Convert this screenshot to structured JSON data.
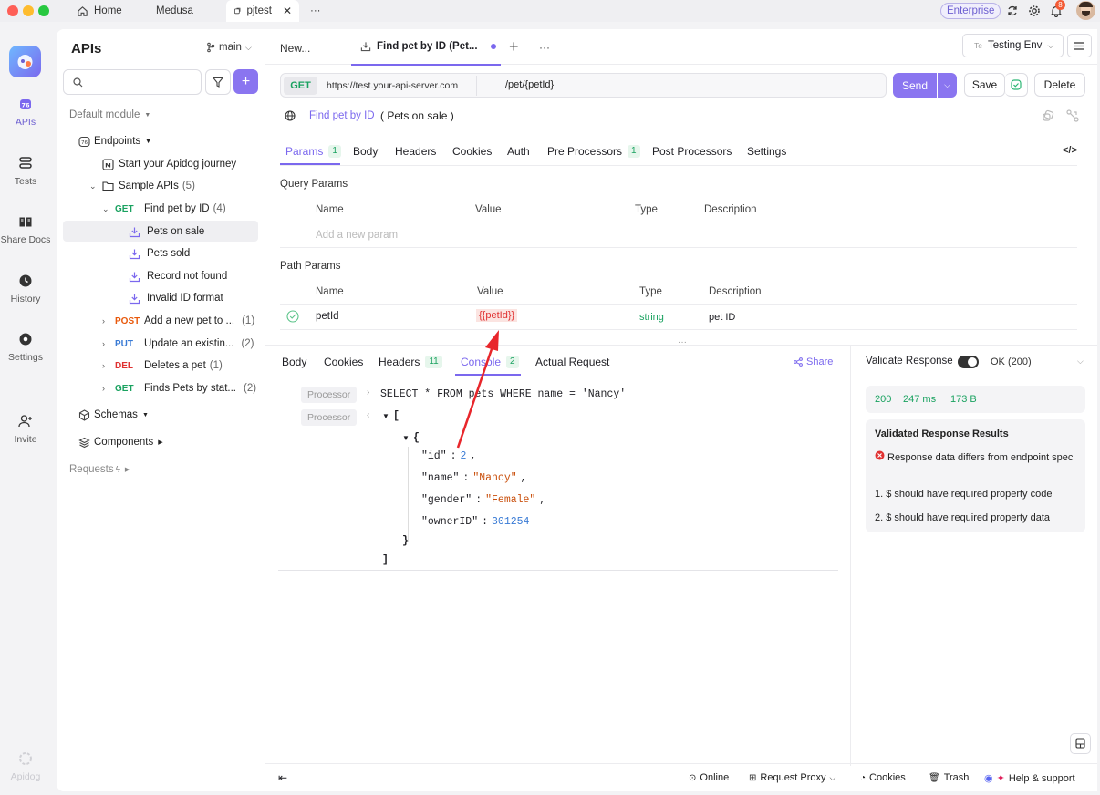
{
  "topbar": {
    "tabs": [
      {
        "label": "Home"
      },
      {
        "label": "Medusa"
      },
      {
        "label": "pjtest"
      }
    ],
    "more": "···",
    "enterprise": "Enterprise",
    "notif_count": "8"
  },
  "rail": {
    "items": [
      {
        "label": "APIs",
        "icon": "apis-icon"
      },
      {
        "label": "Tests",
        "icon": "tests-icon"
      },
      {
        "label": "Share Docs",
        "icon": "share-docs-icon"
      },
      {
        "label": "History",
        "icon": "history-icon"
      },
      {
        "label": "Settings",
        "icon": "settings-icon"
      },
      {
        "label": "Invite",
        "icon": "invite-icon"
      }
    ],
    "brand": "Apidog"
  },
  "sidebar": {
    "title": "APIs",
    "branch": "main",
    "search_placeholder": "",
    "module": "Default module",
    "endpoints_label": "Endpoints",
    "start_journey": "Start your Apidog journey",
    "sample_folder": "Sample APIs",
    "sample_count": "(5)",
    "find_pet": {
      "method": "GET",
      "label": "Find pet by ID",
      "count": "(4)"
    },
    "cases": [
      "Pets on sale",
      "Pets sold",
      "Record not found",
      "Invalid ID format"
    ],
    "others": [
      {
        "method": "POST",
        "label": "Add a new pet to ...",
        "count": "(1)"
      },
      {
        "method": "PUT",
        "label": "Update an existin...",
        "count": "(2)"
      },
      {
        "method": "DEL",
        "label": "Deletes a pet",
        "count": "(1)"
      },
      {
        "method": "GET",
        "label": "Finds Pets by stat...",
        "count": "(2)"
      }
    ],
    "schemas": "Schemas",
    "components": "Components",
    "requests": "Requests"
  },
  "main": {
    "tabs": {
      "new": "New...",
      "active": "Find pet by ID (Pet...",
      "more": "···"
    },
    "env": {
      "prefix": "Te",
      "label": "Testing Env"
    },
    "request": {
      "method": "GET",
      "base_url": "https://test.your-api-server.com",
      "path": "/pet/{petId}",
      "send": "Send",
      "save": "Save",
      "delete": "Delete"
    },
    "breadcrumb": {
      "endpoint": "Find pet by ID",
      "case": "( Pets on sale )"
    },
    "req_tabs": [
      {
        "label": "Params",
        "badge": "1"
      },
      {
        "label": "Body",
        "badge": ""
      },
      {
        "label": "Headers",
        "badge": ""
      },
      {
        "label": "Cookies",
        "badge": ""
      },
      {
        "label": "Auth",
        "badge": ""
      },
      {
        "label": "Pre Processors",
        "badge": "1"
      },
      {
        "label": "Post Processors",
        "badge": ""
      },
      {
        "label": "Settings",
        "badge": ""
      }
    ],
    "query_params": {
      "title": "Query Params",
      "cols": [
        "Name",
        "Value",
        "Type",
        "Description"
      ],
      "placeholder": "Add a new param"
    },
    "path_params": {
      "title": "Path Params",
      "cols": [
        "Name",
        "Value",
        "Type",
        "Description"
      ],
      "row": {
        "name": "petId",
        "value": "{{petId}}",
        "type": "string",
        "description": "pet ID"
      }
    },
    "resp_tabs": [
      {
        "label": "Body",
        "badge": ""
      },
      {
        "label": "Cookies",
        "badge": ""
      },
      {
        "label": "Headers",
        "badge": "11"
      },
      {
        "label": "Console",
        "badge": "2"
      },
      {
        "label": "Actual Request",
        "badge": ""
      }
    ],
    "share": "Share",
    "console": {
      "processor": "Processor",
      "sql": "SELECT * FROM pets WHERE name = 'Nancy'",
      "json": {
        "open_arr": "[",
        "open_obj": "{",
        "close_obj": "}",
        "close_arr": "]",
        "fields": [
          {
            "key": "\"id\"",
            "value": "2",
            "kind": "num"
          },
          {
            "key": "\"name\"",
            "value": "\"Nancy\"",
            "kind": "str"
          },
          {
            "key": "\"gender\"",
            "value": "\"Female\"",
            "kind": "str"
          },
          {
            "key": "\"ownerID\"",
            "value": "301254",
            "kind": "num"
          }
        ]
      }
    },
    "validate": {
      "label": "Validate Response",
      "status": "OK (200)",
      "code": "200",
      "time": "247 ms",
      "size": "173 B",
      "results_title": "Validated Response Results",
      "error": "Response data differs from endpoint spec",
      "items": [
        "1. $ should have required property code",
        "2. $ should have required property data"
      ]
    },
    "footer": {
      "online": "Online",
      "proxy": "Request Proxy",
      "cookies": "Cookies",
      "trash": "Trash",
      "help": "Help & support"
    }
  },
  "colors": {
    "accent": "#7b68ee",
    "get": "#1aa260",
    "post": "#e8590c",
    "put": "#3a7bd5",
    "del": "#e03131",
    "error": "#e03131",
    "annotation": "#e8262b"
  }
}
